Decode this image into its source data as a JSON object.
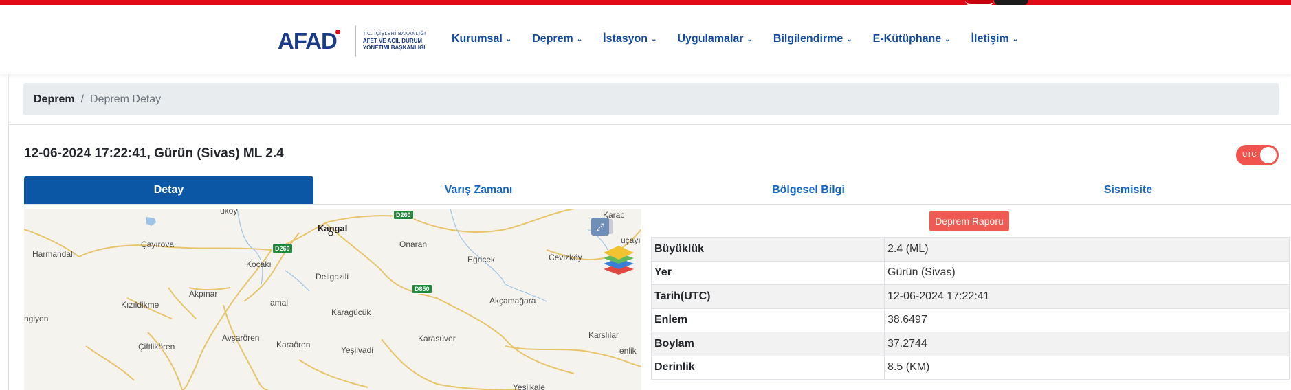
{
  "header": {
    "logo_word": "AFAD",
    "logo_line1": "T.C. İÇİŞLERİ BAKANLIĞI",
    "logo_line2": "AFET VE ACİL DURUM",
    "logo_line3": "YÖNETİMİ BAŞKANLIĞI",
    "nav": [
      {
        "label": "Kurumsal"
      },
      {
        "label": "Deprem"
      },
      {
        "label": "İstasyon"
      },
      {
        "label": "Uygulamalar"
      },
      {
        "label": "Bilgilendirme"
      },
      {
        "label": "E-Kütüphane"
      },
      {
        "label": "İletişim"
      }
    ],
    "nav_chevron_icon": "chevron-down-icon"
  },
  "breadcrumb": {
    "home": "Deprem",
    "separator": "/",
    "current": "Deprem Detay"
  },
  "quake": {
    "title": "12-06-2024 17:22:41, Gürün (Sivas) ML 2.4",
    "utc_toggle_label": "UTC",
    "utc_on": true
  },
  "tabs": [
    {
      "label": "Detay",
      "active": true
    },
    {
      "label": "Varış Zamanı",
      "active": false
    },
    {
      "label": "Bölgesel Bilgi",
      "active": false
    },
    {
      "label": "Sismisite",
      "active": false
    }
  ],
  "map": {
    "cities": [
      "Kangal"
    ],
    "places": [
      "Harmandalı",
      "Çayırova",
      "Kocakı",
      "Deligazili",
      "Onaran",
      "Eğricek",
      "Cevizköy",
      "Kızıldikme",
      "Akpınar",
      "amal",
      "Karagücük",
      "Akçamağara",
      "ngiyen",
      "Avşarören",
      "Karaören",
      "Yeşilvadi",
      "Karasüver",
      "Karslılar",
      "Çiftlikören",
      "Yeşilkale",
      "Karac",
      "uçayı",
      "enlik",
      "üköy"
    ],
    "roads": [
      "D260",
      "D260",
      "D850"
    ],
    "expand_icon": "expand-icon",
    "layers_icon": "layers-icon"
  },
  "report_button": "Deprem Raporu",
  "details": [
    {
      "key": "Büyüklük",
      "value": "2.4 (ML)"
    },
    {
      "key": "Yer",
      "value": "Gürün (Sivas)"
    },
    {
      "key": "Tarih(UTC)",
      "value": "12-06-2024 17:22:41"
    },
    {
      "key": "Enlem",
      "value": "38.6497"
    },
    {
      "key": "Boylam",
      "value": "37.2744"
    },
    {
      "key": "Derinlik",
      "value": "8.5 (KM)"
    }
  ],
  "colors": {
    "brand_red": "#e30a17",
    "brand_blue": "#0b57a6",
    "nav_blue": "#124b9e",
    "report_red": "#ef5b52"
  }
}
